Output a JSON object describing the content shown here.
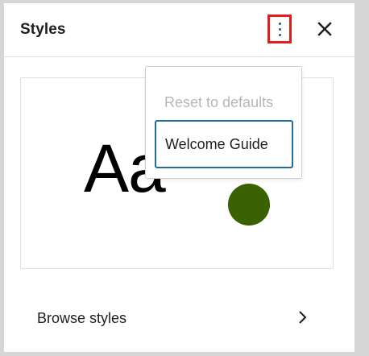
{
  "panel": {
    "title": "Styles"
  },
  "header": {
    "options_icon": "more-vertical-icon",
    "close_icon": "close-icon"
  },
  "preview": {
    "sample_text": "Aa",
    "swatch_color": "#3a6102"
  },
  "options_menu": {
    "items": [
      {
        "label": "Reset to defaults",
        "disabled": true
      },
      {
        "label": "Welcome Guide",
        "focused": true
      }
    ]
  },
  "navigation": {
    "browse_label": "Browse styles",
    "browse_icon": "chevron-right-icon"
  },
  "colors": {
    "highlight": "#e01e1e",
    "focus_ring": "#1f6e9b",
    "accent": "#1e5b8a"
  }
}
